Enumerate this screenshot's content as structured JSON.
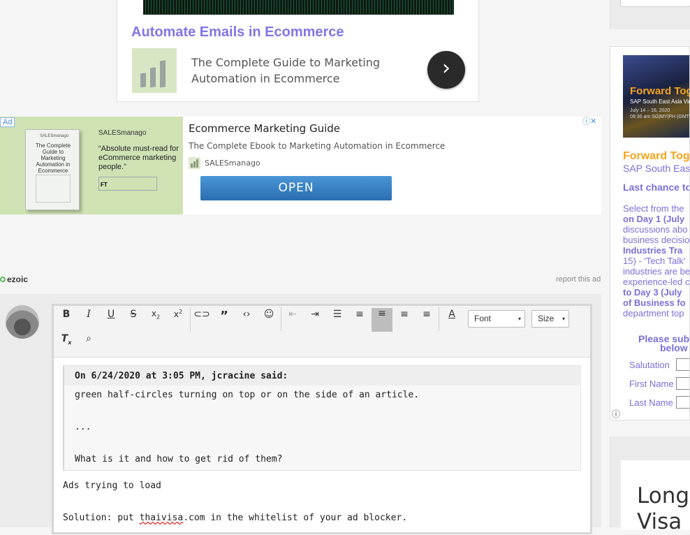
{
  "top_card": {
    "title": "Automate Emails in Ecommerce",
    "description": "The Complete Guide to Marketing Automation in Ecommerce",
    "next_icon": "chevron-right-icon"
  },
  "ad_banner": {
    "ad_tag": "Ad",
    "book_brand": "SALESmanago",
    "book_title": "The Complete Guide to Marketing Automation in Ecommerce",
    "brand": "SALESmanago",
    "quote": "“Absolute must-read for eCommerce marketing people.”",
    "headline": "Ecommerce Marketing Guide",
    "description": "The Complete Ebook to Marketing Automation in Ecommerce",
    "source": "SALESmanago",
    "cta": "OPEN",
    "adchoices": "ⓘ✕"
  },
  "ezoic": {
    "label": "ezoic",
    "report": "report this ad"
  },
  "editor": {
    "toolbar": {
      "font_label": "Font",
      "size_label": "Size"
    },
    "quote": {
      "header": "On 6/24/2020 at 3:05 PM, jcracine said:",
      "lines": [
        "green half-circles turning on top or on the side of an article.",
        "...",
        "What is it and how to get rid of them?"
      ]
    },
    "reply": {
      "line1": "Ads trying to load",
      "line2_prefix": "Solution:  put ",
      "line2_link": "thaivisa",
      "line2_suffix": ".com in the whitelist of your ad blocker."
    }
  },
  "right_ad": {
    "image_title": "Forward Together",
    "image_sub": "SAP South East Asia Virtual",
    "image_date": "July 14 – 16, 2020",
    "image_time": "09:30 am SG|MY|PH (GMT +8)",
    "headline": "Forward Together",
    "subhead": "SAP South East Asia",
    "last_chance": "Last chance to",
    "body_lines": [
      {
        "text": "Select from the",
        "bold": false
      },
      {
        "text": "on Day 1 (July",
        "bold": true
      },
      {
        "text": "discussions abo",
        "bold": false
      },
      {
        "text": "business decisio",
        "bold": false
      },
      {
        "text": "Industries Tra",
        "bold": true
      },
      {
        "text": "15) - 'Tech Talk'",
        "bold": false
      },
      {
        "text": "industries are be",
        "bold": false
      },
      {
        "text": "experience-led c",
        "bold": false
      },
      {
        "text": "to Day 3  (July",
        "bold": true
      },
      {
        "text": "of Business fo",
        "bold": true
      },
      {
        "text": "department top",
        "bold": false
      }
    ],
    "form_prompt": "Please sub",
    "form_prompt2": "below",
    "fields": [
      "Salutation",
      "First Name",
      "Last Name"
    ],
    "info_icon": "ⓘ"
  },
  "right_bottom": {
    "text_line1": "Long",
    "text_line2": "Visa i"
  },
  "colors": {
    "accent": "#8076e8",
    "cta_blue": "#2a6eb0",
    "orange": "#f6a51a"
  }
}
